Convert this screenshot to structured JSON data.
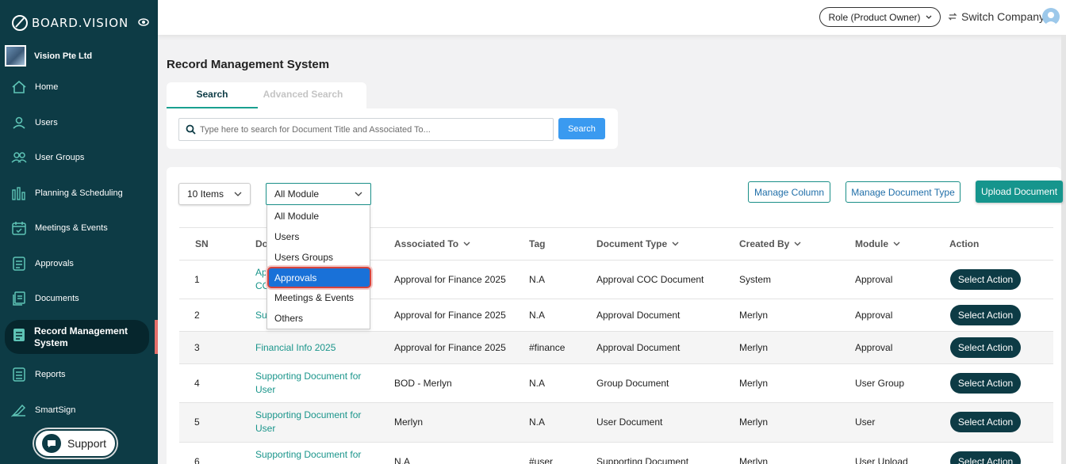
{
  "app": {
    "logo_text": "BOARD.VISION",
    "company": "Vision Pte Ltd"
  },
  "sidebar": {
    "items": [
      {
        "label": "Home",
        "icon": "home-icon"
      },
      {
        "label": "Users",
        "icon": "user-icon"
      },
      {
        "label": "User Groups",
        "icon": "users-icon"
      },
      {
        "label": "Planning & Scheduling",
        "icon": "chart-bars-icon"
      },
      {
        "label": "Meetings & Events",
        "icon": "calendar-icon"
      },
      {
        "label": "Approvals",
        "icon": "checklist-icon"
      },
      {
        "label": "Documents",
        "icon": "documents-icon"
      },
      {
        "label": "Record Management System",
        "icon": "record-icon"
      },
      {
        "label": "Reports",
        "icon": "report-icon"
      },
      {
        "label": "SmartSign",
        "icon": "signature-icon"
      }
    ],
    "active": "Record Management System",
    "support_label": "Support"
  },
  "topbar": {
    "role_label": "Role (Product Owner)",
    "switch_label": "Switch Company"
  },
  "page": {
    "title": "Record Management System"
  },
  "search": {
    "tabs": [
      "Search",
      "Advanced Search"
    ],
    "placeholder": "Type here to search for Document Title and Associated To...",
    "button": "Search"
  },
  "toolbar": {
    "items_per_page": "10 Items",
    "module_filter": "All Module",
    "manage_column": "Manage Column",
    "manage_doc_type": "Manage Document Type",
    "upload": "Upload Document"
  },
  "module_dropdown": {
    "options": [
      "All Module",
      "Users",
      "Users Groups",
      "Approvals",
      "Meetings & Events",
      "Others"
    ],
    "highlighted": "Approvals"
  },
  "table": {
    "headers": [
      "SN",
      "Do",
      "Associated To",
      "Tag",
      "Document Type",
      "Created By",
      "Module",
      "Action"
    ],
    "rows": [
      {
        "sn": "1",
        "doc": "Ap",
        "doc2": "CO",
        "assoc": "Approval for Finance 2025",
        "tag": "N.A",
        "type": "Approval COC Document",
        "by": "System",
        "module": "Approval",
        "action": "Select Action"
      },
      {
        "sn": "2",
        "doc": "Su",
        "assoc": "Approval for Finance 2025",
        "tag": "N.A",
        "type": "Approval Document",
        "by": "Merlyn",
        "module": "Approval",
        "action": "Select Action"
      },
      {
        "sn": "3",
        "doc": "Financial Info 2025",
        "assoc": "Approval for Finance 2025",
        "tag": "#finance",
        "type": "Approval Document",
        "by": "Merlyn",
        "module": "Approval",
        "action": "Select Action"
      },
      {
        "sn": "4",
        "doc": "Supporting Document for",
        "doc2": "User",
        "assoc": "BOD - Merlyn",
        "tag": "N.A",
        "type": "Group Document",
        "by": "Merlyn",
        "module": "User Group",
        "action": "Select Action"
      },
      {
        "sn": "5",
        "doc": "Supporting Document for",
        "doc2": "User",
        "assoc": "Merlyn",
        "tag": "N.A",
        "type": "User Document",
        "by": "Merlyn",
        "module": "User",
        "action": "Select Action"
      },
      {
        "sn": "6",
        "doc": "Supporting Document for",
        "assoc": "N.A",
        "tag": "#user",
        "type": "Supporting Document",
        "by": "Merlyn",
        "module": "User Upload",
        "action": "Select Action"
      }
    ]
  }
}
